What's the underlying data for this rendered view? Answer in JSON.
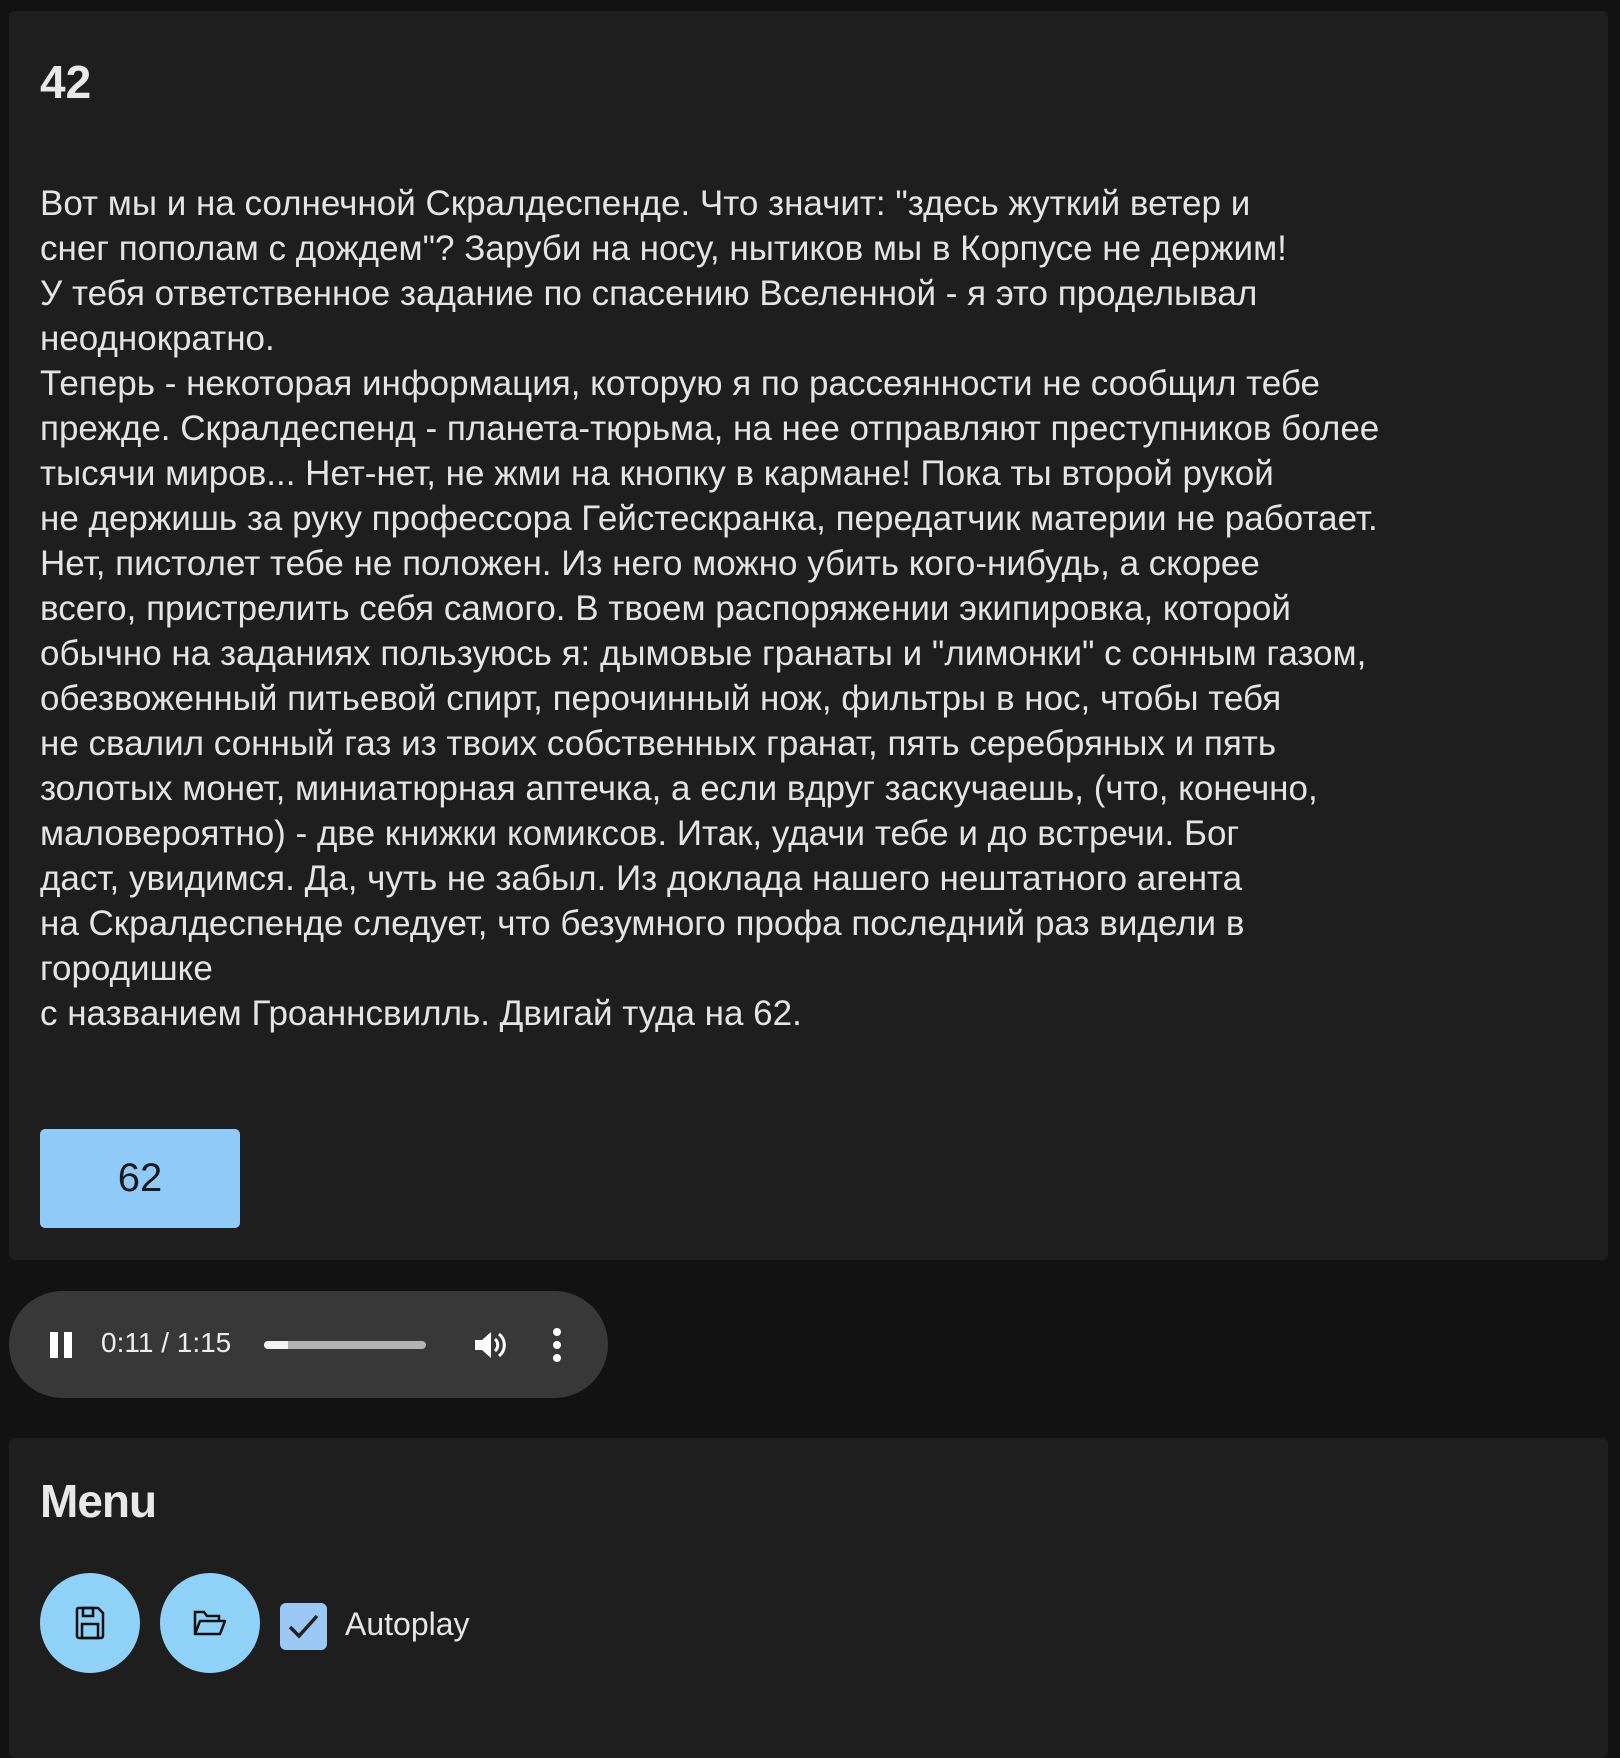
{
  "story": {
    "title": "42",
    "lines": [
      "Вот мы и на солнечной Скралдеспенде. Что значит: \"здесь жуткий ветер и",
      "снег пополам с дождем\"? Заруби на носу, нытиков мы в Корпусе не держим!",
      "У тебя ответственное задание по спасению Вселенной - я это проделывал",
      "неоднократно.",
      "Теперь - некоторая информация, которую я по рассеянности не сообщил тебе",
      "прежде. Скралдеспенд - планета-тюрьма, на нее отправляют преступников более",
      "тысячи миров... Нет-нет, не жми на кнопку в кармане! Пока ты второй рукой",
      "не держишь за руку профессора Гейстескранка, передатчик материи не работает.",
      "Нет, пистолет тебе не положен. Из него можно убить кого-нибудь, а скорее",
      "всего, пристрелить себя самого. В твоем распоряжении экипировка, которой",
      "обычно на заданиях пользуюсь я: дымовые гранаты и \"лимонки\" с сонным газом,",
      "обезвоженный питьевой спирт, перочинный нож, фильтры в нос, чтобы тебя",
      "не свалил сонный газ из твоих собственных гранат, пять серебряных и пять",
      "золотых монет, миниатюрная аптечка, а если вдруг заскучаешь, (что, конечно,",
      "маловероятно) - две книжки комиксов. Итак, удачи тебе и до встречи. Бог",
      "даст, увидимся. Да, чуть не забыл. Из доклада нашего нештатного агента",
      "на Скралдеспенде следует, что безумного профа последний раз видели в",
      "городишке",
      "с названием Гроаннсвилль. Двигай туда на 62."
    ],
    "choices": [
      {
        "label": "62"
      }
    ]
  },
  "audio": {
    "state": "playing",
    "time": "0:11 / 1:15",
    "progress_fraction": 0.147,
    "icons": [
      "pause-icon",
      "volume-icon",
      "more-vert-icon"
    ]
  },
  "menu": {
    "title": "Menu",
    "save_icon": "floppy-disk-icon",
    "load_icon": "folder-open-icon",
    "autoplay": {
      "label": "Autoplay",
      "checked": true
    }
  },
  "colors": {
    "background": "#121212",
    "card": "#1e1e1e",
    "primary": "#90caf9",
    "audio_bg": "#383838"
  }
}
